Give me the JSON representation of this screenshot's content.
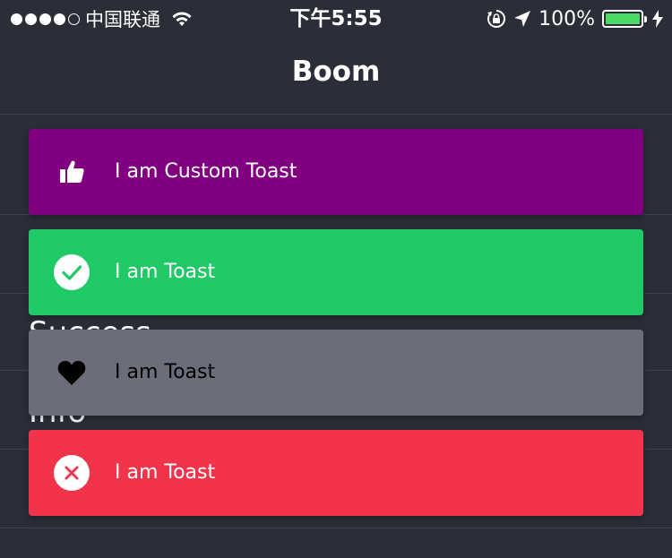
{
  "status_bar": {
    "carrier": "中国联通",
    "time": "下午5:55",
    "battery": "100%",
    "battery_level": 1.0
  },
  "nav": {
    "title": "Boom"
  },
  "list": {
    "items": [
      {
        "label": "Success"
      },
      {
        "label": "Info"
      }
    ]
  },
  "toasts": [
    {
      "text": "I am Custom Toast",
      "icon": "thumbs-up-icon",
      "background": "#800080",
      "text_color": "#ffffff"
    },
    {
      "text": "I am Toast",
      "icon": "check-circle-icon",
      "background": "#1fc965",
      "text_color": "#ffffff"
    },
    {
      "text": "I am Toast",
      "icon": "heart-icon",
      "background": "#6b6d7b",
      "text_color": "#000000"
    },
    {
      "text": "I am Toast",
      "icon": "close-circle-icon",
      "background": "#f1344a",
      "text_color": "#ffffff"
    }
  ]
}
